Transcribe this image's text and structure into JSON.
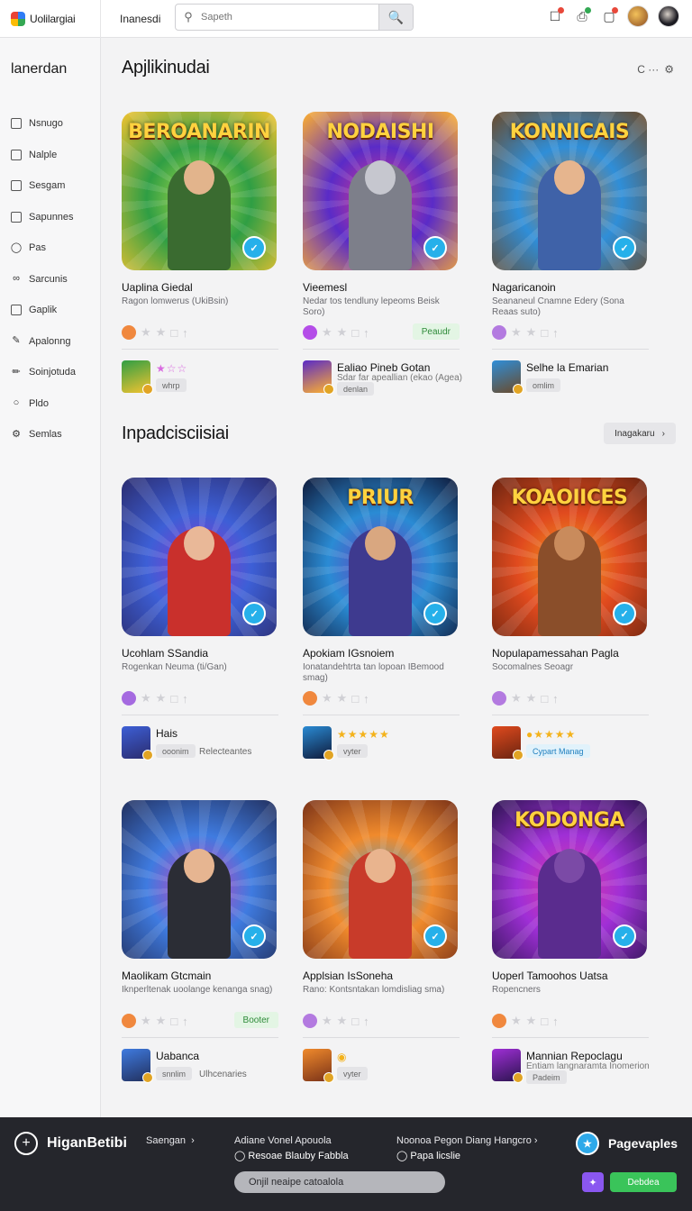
{
  "header": {
    "brand": "Uolilargiai",
    "tab": "Inanesdi",
    "search_placeholder": "Sapeth",
    "search_icon": "search-icon",
    "icons": [
      "bag-icon",
      "download-icon",
      "notifications-icon"
    ]
  },
  "sidebar": {
    "title": "lanerdan",
    "items": [
      {
        "label": "Nsnugo",
        "icon": "square-icon"
      },
      {
        "label": "Nalple",
        "icon": "square-icon"
      },
      {
        "label": "Sesgam",
        "icon": "square-icon"
      },
      {
        "label": "Sapunnes",
        "icon": "square-icon"
      },
      {
        "label": "Pas",
        "icon": "tag-icon"
      },
      {
        "label": "Sarcunis",
        "icon": "link-icon"
      },
      {
        "label": "Gaplik",
        "icon": "square-icon"
      },
      {
        "label": "Apalonng",
        "icon": "pen-icon"
      },
      {
        "label": "Soinjotuda",
        "icon": "pencil-icon"
      },
      {
        "label": "Pldo",
        "icon": "chat-icon"
      },
      {
        "label": "Semlas",
        "icon": "settings-icon"
      }
    ]
  },
  "section1": {
    "title": "Apjlikinudai",
    "tools": "C ···",
    "cards": [
      {
        "thumb_title": "BEROANARIN",
        "badge": "",
        "name": "Uaplina Giedal",
        "desc": "Ragon lomwerus (UkiBsin)",
        "tag": "",
        "dev_name": "",
        "dev_chip": "whrp",
        "dev_extra": "",
        "stars": "★☆☆",
        "colors": [
          "#2f9e44",
          "#b8e04a",
          "#f4c330"
        ],
        "figure": "#3a6b30",
        "head": "#e2b48c",
        "icon_color": "#f0883e",
        "title_color": "#ffd23f"
      },
      {
        "thumb_title": "NODAISHI",
        "badge": "",
        "name": "Vieemesl",
        "desc": "Nedar tos tendluny lepeoms Beisk Soro)",
        "tag": "Peaudr",
        "dev_name": "Ealiao Pineb Gotan",
        "dev_sub": "Sdar far apeallian (ekao (Agea)",
        "dev_chip": "denlan",
        "dev_extra": "",
        "stars": "",
        "colors": [
          "#5a2bc7",
          "#e03c8a",
          "#ffb12e"
        ],
        "figure": "#7d7f8a",
        "head": "#c6c7cf",
        "icon_color": "#b44de8",
        "title_color": "#ffd23f"
      },
      {
        "thumb_title": "KONNICAIS",
        "badge": "",
        "name": "Nagaricanoin",
        "desc": "Seananeul Cnamne Edery (Sona Reaas suto)",
        "tag": "",
        "dev_name": "Selhe la Emarian",
        "dev_chip": "omlim",
        "dev_extra": "",
        "stars": "",
        "colors": [
          "#2f8ed8",
          "#b47b3f",
          "#6a4a2a"
        ],
        "figure": "#3f62a8",
        "head": "#e6b58e",
        "icon_color": "#b37ae0",
        "title_color": "#ffd23f"
      }
    ]
  },
  "section2": {
    "title": "Inpadcisciisiai",
    "button": "Inagakaru",
    "cards": [
      {
        "thumb_title": "",
        "badge": "",
        "name": "Ucohlam SSandia",
        "desc": "Rogenkan Neuma (ti/Gan)",
        "tag": "",
        "dev_name": "Hais",
        "dev_chip": "ooonim",
        "dev_extra": "Relecteantes",
        "stars": "",
        "colors": [
          "#3d5fd6",
          "#8e3ad0",
          "#2b2c6e"
        ],
        "figure": "#c9302c",
        "head": "#e9b898",
        "icon_color": "#a56ae0",
        "title_color": "#ffd23f"
      },
      {
        "thumb_title": "PRIUR",
        "badge": "",
        "name": "Apokiam IGsnoiem",
        "desc": "Ionatandehtrta tan lopoan IBemood smag)",
        "tag": "",
        "dev_name": "",
        "dev_chip": "vyter",
        "dev_extra": "",
        "stars": "★★★★★",
        "colors": [
          "#2a8bd4",
          "#6d3dbd",
          "#0f1a3a"
        ],
        "figure": "#3e3a8f",
        "head": "#d9a780",
        "icon_color": "#f0883e",
        "title_color": "#ffd23f"
      },
      {
        "thumb_title": "KOAOIICES",
        "badge": "",
        "name": "Nopulapamessahan Pagla",
        "desc": "Socomalnes Seoagr",
        "tag": "",
        "dev_name": "",
        "dev_chip": "Cypart Manag",
        "dev_extra": "",
        "stars": "●★★★★",
        "colors": [
          "#e04a1e",
          "#f7a021",
          "#6b2410"
        ],
        "figure": "#8a4e2a",
        "head": "#c98b5c",
        "icon_color": "#b37ae0",
        "title_color": "#ffd23f"
      }
    ],
    "cards_row2": [
      {
        "thumb_title": "",
        "badge": "",
        "name": "Maolikam Gtcmain",
        "desc": "Iknperltenak uoolange kenanga snag)",
        "tag": "Booter",
        "dev_name": "Uabanca",
        "dev_chip": "snnlim",
        "dev_extra": "Ulhcenaries",
        "stars": "",
        "colors": [
          "#3f7be0",
          "#d040b8",
          "#22305e"
        ],
        "figure": "#2b2d35",
        "head": "#e6b591",
        "icon_color": "#f0883e",
        "title_color": "#ffd23f"
      },
      {
        "thumb_title": "",
        "badge": "",
        "name": "Applsian IsSoneha",
        "desc": "Rano: Kontsntakan lomdisliag sma)",
        "tag": "",
        "dev_name": "",
        "dev_chip": "vyter",
        "dev_extra": "",
        "stars": "◉",
        "colors": [
          "#f08a2c",
          "#3ba0e0",
          "#7a3218"
        ],
        "figure": "#c83b2a",
        "head": "#e9b48e",
        "icon_color": "#b37ae0",
        "title_color": "#ffd23f"
      },
      {
        "thumb_title": "KODONGA",
        "badge": "",
        "name": "Uoperl Tamoohos Uatsa",
        "desc": "Ropencners",
        "tag": "",
        "dev_name": "Mannian Repoclagu",
        "dev_sub": "Entiam langnaramta Inomerion",
        "dev_chip": "Padeim",
        "dev_extra": "",
        "stars": "",
        "colors": [
          "#9f2fd6",
          "#e23aa4",
          "#2c1450"
        ],
        "figure": "#5a2c8e",
        "head": "#7b4aa6",
        "icon_color": "#f0883e",
        "title_color": "#ffd23f"
      }
    ]
  },
  "footer": {
    "brand": "HiganBetibi",
    "link1": "Saengan",
    "link2": "Adiane Vonel Apouola",
    "link2_sub": "Resoae Blauby Fabbla",
    "link3": "Noonoa Pegon Diang Hangcro",
    "link3_sub": "Papa licslie",
    "right": "Pagevaples",
    "input_placeholder": "Onjil neaipe catoalola",
    "button": "Debdea"
  }
}
